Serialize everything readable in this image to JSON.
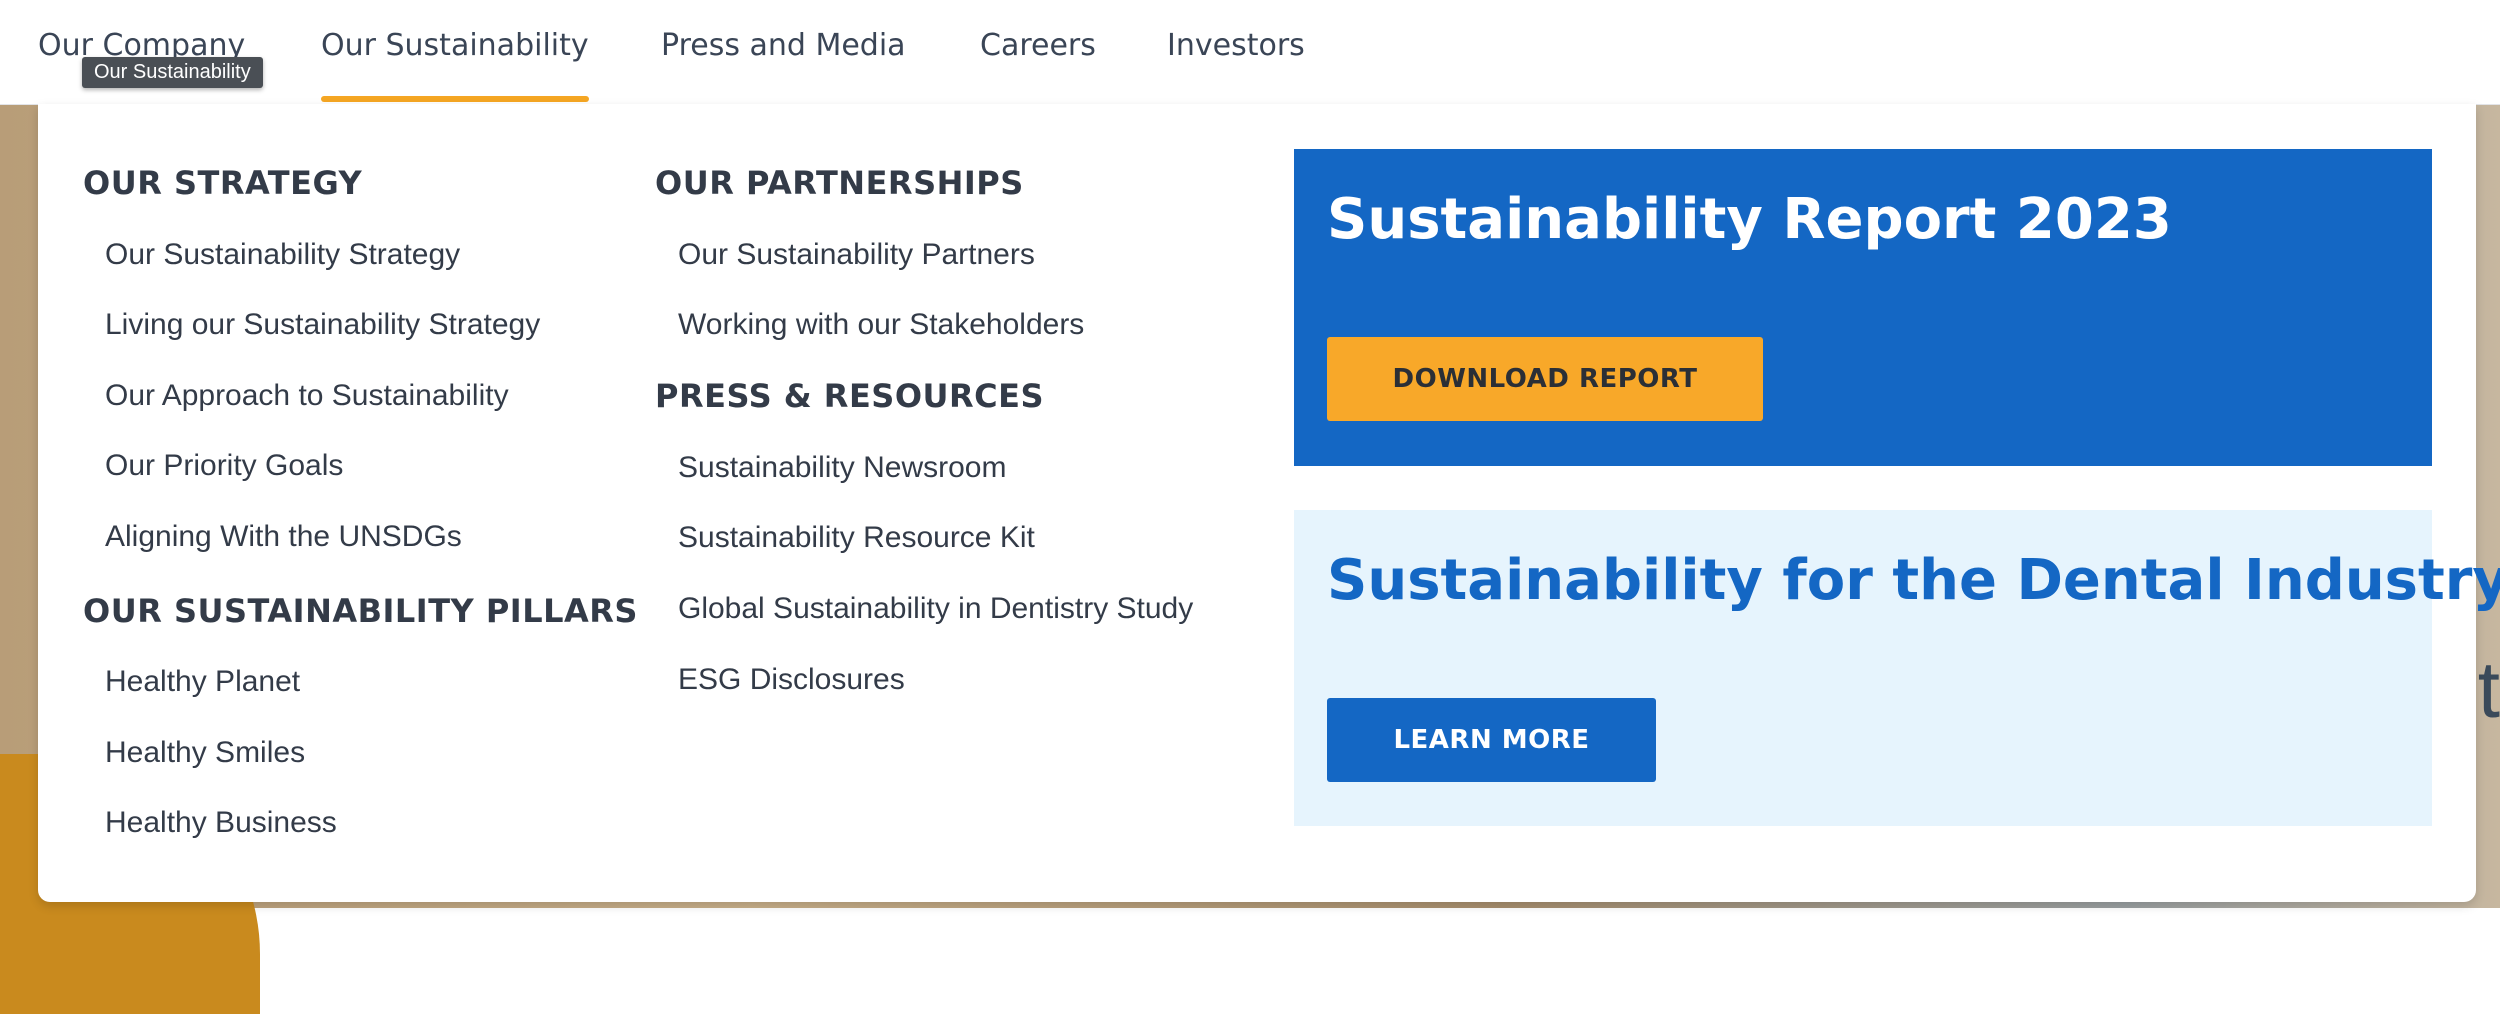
{
  "topnav": {
    "items": [
      {
        "label": "Our Company"
      },
      {
        "label": "Our Sustainability"
      },
      {
        "label": "Press and Media"
      },
      {
        "label": "Careers"
      },
      {
        "label": "Investors"
      }
    ],
    "tooltip": "Our Sustainability",
    "active_index": 1
  },
  "menu": {
    "col1": {
      "strategy_heading": "OUR STRATEGY",
      "strategy_links": [
        "Our Sustainability Strategy",
        "Living our Sustainability Strategy",
        "Our Approach to Sustainability",
        "Our Priority Goals",
        "Aligning With the UNSDGs"
      ],
      "pillars_heading": "OUR SUSTAINABILITY PILLARS",
      "pillars_links": [
        "Healthy Planet",
        "Healthy Smiles",
        "Healthy Business"
      ]
    },
    "col2": {
      "partnerships_heading": "OUR PARTNERSHIPS",
      "partnerships_links": [
        "Our Sustainability Partners",
        "Working with our Stakeholders"
      ],
      "press_heading": "PRESS & RESOURCES",
      "press_links": [
        "Sustainability Newsroom",
        "Sustainability Resource Kit",
        "Global Sustainability in Dentistry Study",
        "ESG Disclosures"
      ]
    }
  },
  "promos": {
    "report": {
      "title": "Sustainability Report 2023",
      "button": "DOWNLOAD REPORT"
    },
    "dental": {
      "title": "Sustainability for the Dental Industry",
      "button": "LEARN MORE"
    }
  },
  "hero": {
    "partial_glyph": "t"
  },
  "colors": {
    "accent": "#f5a623",
    "brand_blue": "#1467c4",
    "light_blue": "#e6f4fd",
    "text": "#333b48"
  }
}
